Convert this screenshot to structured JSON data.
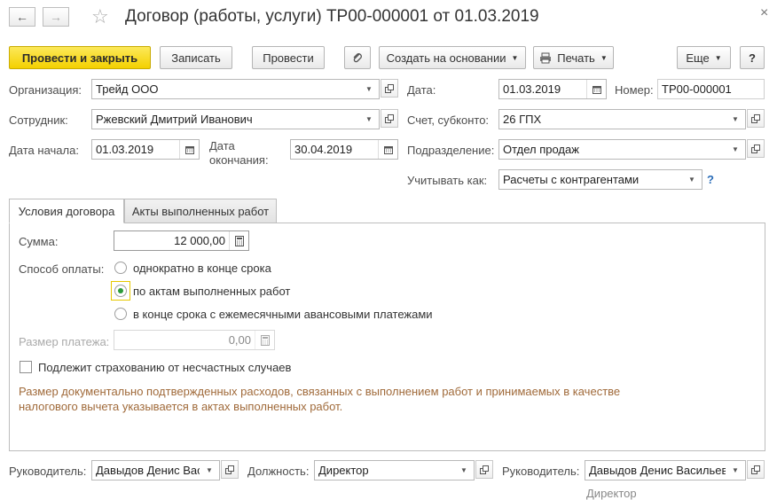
{
  "window": {
    "title": "Договор (работы, услуги) ТР00-000001 от 01.03.2019",
    "close_glyph": "×"
  },
  "toolbar": {
    "post_close": "Провести и закрыть",
    "save": "Записать",
    "post": "Провести",
    "create_based": "Создать на основании",
    "print": "Печать",
    "more": "Еще",
    "help": "?"
  },
  "header": {
    "org_label": "Организация:",
    "org_value": "Трейд ООО",
    "employee_label": "Сотрудник:",
    "employee_value": "Ржевский Дмитрий Иванович",
    "start_label": "Дата начала:",
    "start_value": "01.03.2019",
    "end_label_1": "Дата",
    "end_label_2": "окончания:",
    "end_value": "30.04.2019",
    "date_label": "Дата:",
    "date_value": "01.03.2019",
    "number_label": "Номер:",
    "number_value": "ТР00-000001",
    "account_label": "Счет, субконто:",
    "account_value": "26 ГПХ",
    "dept_label": "Подразделение:",
    "dept_value": "Отдел продаж",
    "account_as_label": "Учитывать как:",
    "account_as_value": "Расчеты с контрагентами",
    "help_q": "?"
  },
  "tabs": [
    {
      "label": "Условия договора",
      "active": true
    },
    {
      "label": "Акты выполненных работ",
      "active": false
    }
  ],
  "terms": {
    "sum_label": "Сумма:",
    "sum_value": "12 000,00",
    "payment_label": "Способ оплаты:",
    "payment_options": [
      {
        "label": "однократно в конце срока",
        "selected": false
      },
      {
        "label": "по актам выполненных работ",
        "selected": true
      },
      {
        "label": "в конце срока с ежемесячными авансовыми платежами",
        "selected": false
      }
    ],
    "payment_size_label": "Размер платежа:",
    "payment_size_value": "0,00",
    "insurance_label": "Подлежит страхованию от несчастных случаев",
    "insurance_checked": false,
    "note_line1": "Размер документально подтвержденных расходов, связанных с выполнением работ и принимаемых в качестве",
    "note_line2": "налогового вычета указывается в актах выполненных работ."
  },
  "footer": {
    "head_label": "Руководитель:",
    "head_value": "Давыдов Денис Вас",
    "position_label": "Должность:",
    "position_value": "Директор",
    "head2_label": "Руководитель:",
    "head2_value": "Давыдов Денис Васильев",
    "head2_caption": "Директор"
  },
  "colors": {
    "primary_button": "#f4d100",
    "note_text": "#a06a3a",
    "help_blue": "#2a6cb8",
    "radio_on": "#2a9a3a"
  }
}
